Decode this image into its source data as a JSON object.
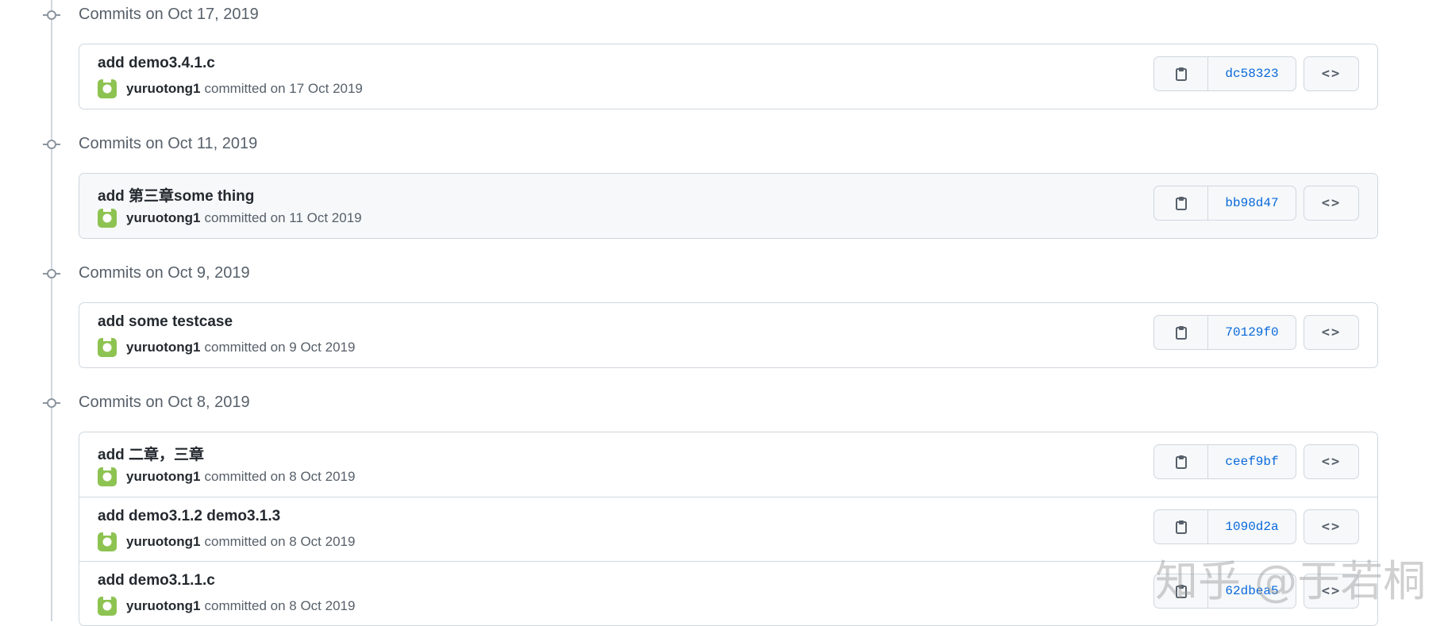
{
  "groups": [
    {
      "title": "Commits on Oct 17, 2019",
      "commits": [
        {
          "message": "add demo3.4.1.c",
          "author": "yuruotong1",
          "committed_text": "committed on 17 Oct 2019",
          "sha": "dc58323",
          "browse_label": "<>"
        }
      ]
    },
    {
      "title": "Commits on Oct 11, 2019",
      "commits": [
        {
          "message": "add 第三章some thing",
          "author": "yuruotong1",
          "committed_text": "committed on 11 Oct 2019",
          "sha": "bb98d47",
          "browse_label": "<>"
        }
      ]
    },
    {
      "title": "Commits on Oct 9, 2019",
      "commits": [
        {
          "message": "add some testcase",
          "author": "yuruotong1",
          "committed_text": "committed on 9 Oct 2019",
          "sha": "70129f0",
          "browse_label": "<>"
        }
      ]
    },
    {
      "title": "Commits on Oct 8, 2019",
      "commits": [
        {
          "message": "add 二章，三章",
          "author": "yuruotong1",
          "committed_text": "committed on 8 Oct 2019",
          "sha": "ceef9bf",
          "browse_label": "<>"
        },
        {
          "message": "add demo3.1.2 demo3.1.3",
          "author": "yuruotong1",
          "committed_text": "committed on 8 Oct 2019",
          "sha": "1090d2a",
          "browse_label": "<>"
        },
        {
          "message": "add demo3.1.1.c",
          "author": "yuruotong1",
          "committed_text": "committed on 8 Oct 2019",
          "sha": "62dbea5",
          "browse_label": "<>"
        }
      ]
    }
  ],
  "watermark": "知乎 @于若桐",
  "colors": {
    "sha_link": "#0969da",
    "border": "#d0d7de",
    "avatar": "#8dc351"
  }
}
